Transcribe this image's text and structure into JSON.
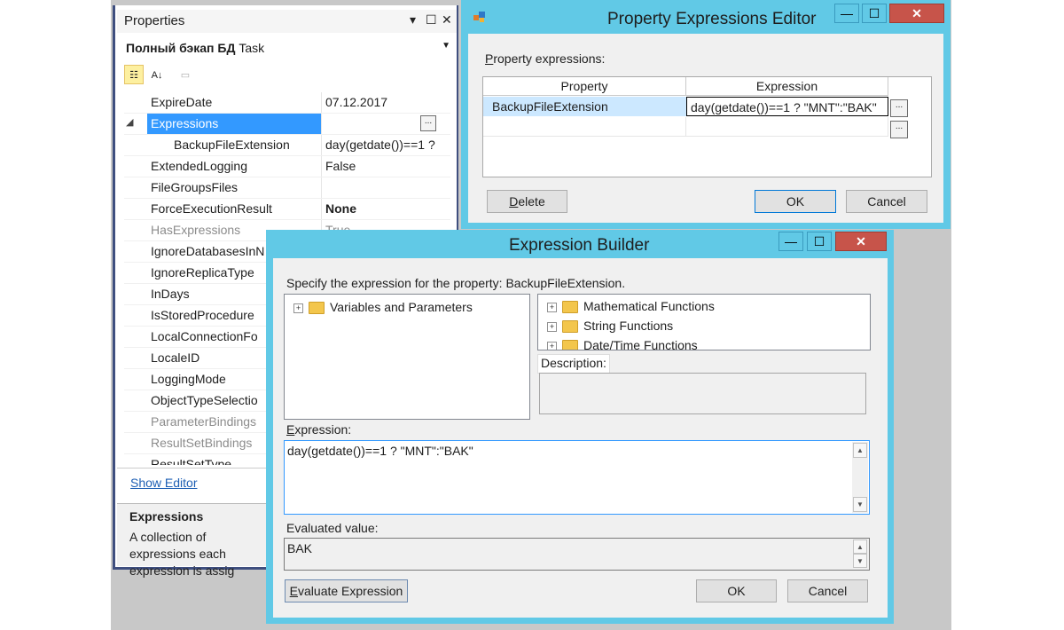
{
  "properties_panel": {
    "title": "Properties",
    "title_controls": [
      "▾",
      "☐",
      "✕"
    ],
    "object": {
      "name": "Полный бэкап БД",
      "type": "Task"
    },
    "rows": [
      {
        "name": "ExpireDate",
        "value": "07.12.2017"
      },
      {
        "name": "Expressions",
        "value": "",
        "expand": "◢",
        "ellipsis": "..."
      },
      {
        "name": "BackupFileExtension",
        "value": "day(getdate())==1 ?"
      },
      {
        "name": "ExtendedLogging",
        "value": "False"
      },
      {
        "name": "FileGroupsFiles",
        "value": ""
      },
      {
        "name": "ForceExecutionResult",
        "value": "None"
      },
      {
        "name": "HasExpressions",
        "value": "True"
      },
      {
        "name": "IgnoreDatabasesInN",
        "value": ""
      },
      {
        "name": "IgnoreReplicaType",
        "value": ""
      },
      {
        "name": "InDays",
        "value": ""
      },
      {
        "name": "IsStoredProcedure",
        "value": ""
      },
      {
        "name": "LocalConnectionFo",
        "value": ""
      },
      {
        "name": "LocaleID",
        "value": ""
      },
      {
        "name": "LoggingMode",
        "value": ""
      },
      {
        "name": "ObjectTypeSelectio",
        "value": ""
      },
      {
        "name": "ParameterBindings",
        "value": ""
      },
      {
        "name": "ResultSetBindings",
        "value": ""
      },
      {
        "name": "ResultSetType",
        "value": ""
      }
    ],
    "show_editor": "Show Editor",
    "desc_title": "Expressions",
    "desc_text": "A collection of expressions each expression is assig"
  },
  "property_expressions_editor": {
    "title": "Property Expressions Editor",
    "label": "Property expressions:",
    "col_property": "Property",
    "col_expression": "Expression",
    "row_property": "BackupFileExtension",
    "row_expression": "day(getdate())==1 ? \"MNT\":\"BAK\"",
    "ellipsis": "...",
    "delete": "Delete",
    "ok": "OK",
    "cancel": "Cancel",
    "win_min": "—",
    "win_max": "☐",
    "win_close": "✕"
  },
  "expression_builder": {
    "title": "Expression Builder",
    "specify": "Specify the expression for the property: BackupFileExtension.",
    "left_tree": [
      {
        "label": "Variables and Parameters"
      }
    ],
    "right_tree": [
      {
        "label": "Mathematical Functions"
      },
      {
        "label": "String Functions"
      },
      {
        "label": "Date/Time Functions"
      }
    ],
    "plus": "+",
    "description_label": "Description:",
    "expression_label": "Expression:",
    "expression": "day(getdate())==1 ? \"MNT\":\"BAK\"",
    "evaluated_label": "Evaluated value:",
    "evaluated": "BAK",
    "evaluate_button": "Evaluate Expression",
    "ok": "OK",
    "cancel": "Cancel",
    "win_min": "—",
    "win_max": "☐",
    "win_close": "✕",
    "arrow_up": "▲",
    "arrow_down": "▼"
  }
}
